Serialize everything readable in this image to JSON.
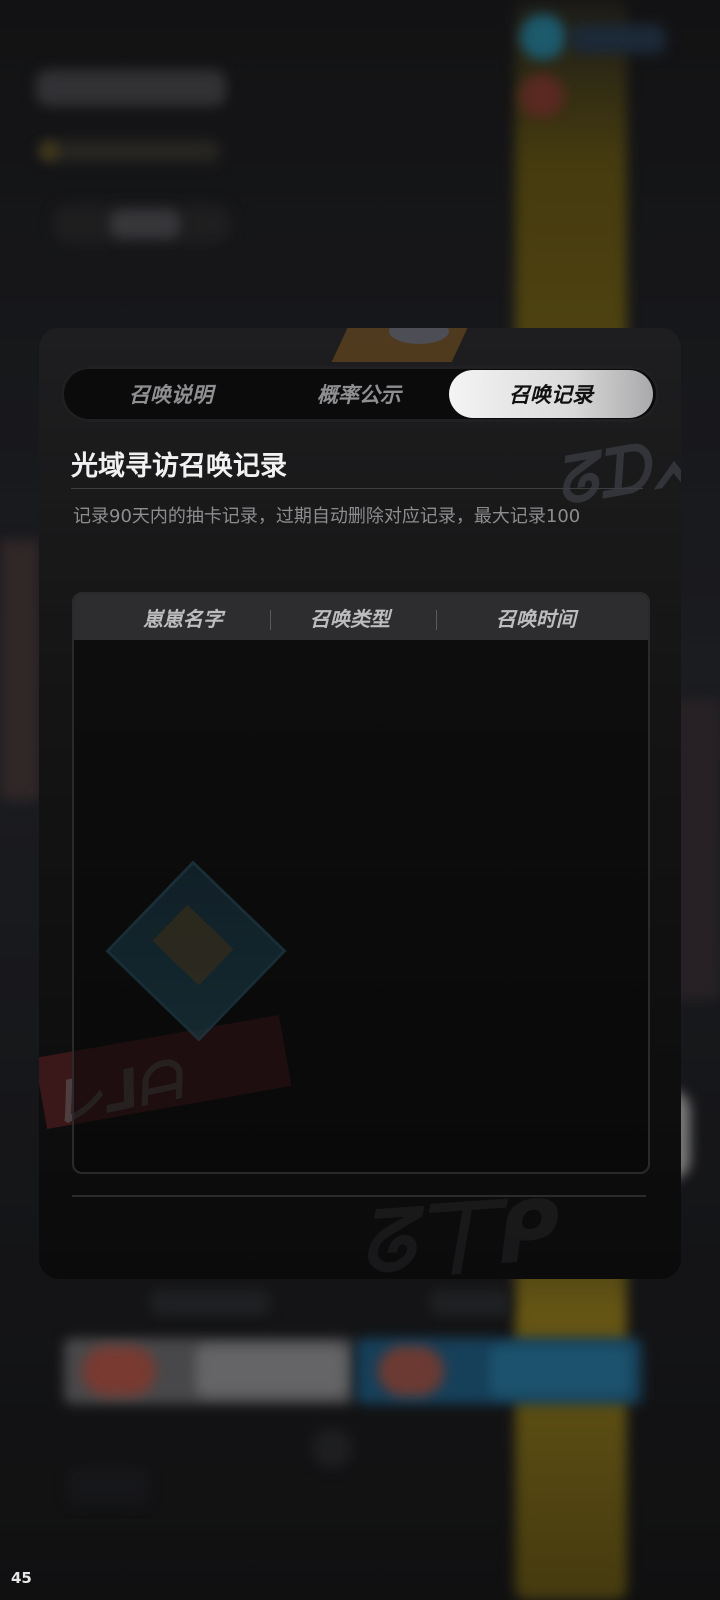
{
  "tabs": [
    {
      "label": "召唤说明",
      "active": false
    },
    {
      "label": "概率公示",
      "active": false
    },
    {
      "label": "召唤记录",
      "active": true
    }
  ],
  "record": {
    "title": "光域寻访召唤记录",
    "description": "记录90天内的抽卡记录，过期自动删除对应记录，最大记录100",
    "columns": [
      "崽崽名字",
      "召唤类型",
      "召唤时间"
    ],
    "rows": []
  },
  "status": {
    "corner_number": "45"
  },
  "colors": {
    "active_tab": "#e8e8e8",
    "panel_bg": "#141414",
    "accent_yellow": "#7d6a1c"
  }
}
